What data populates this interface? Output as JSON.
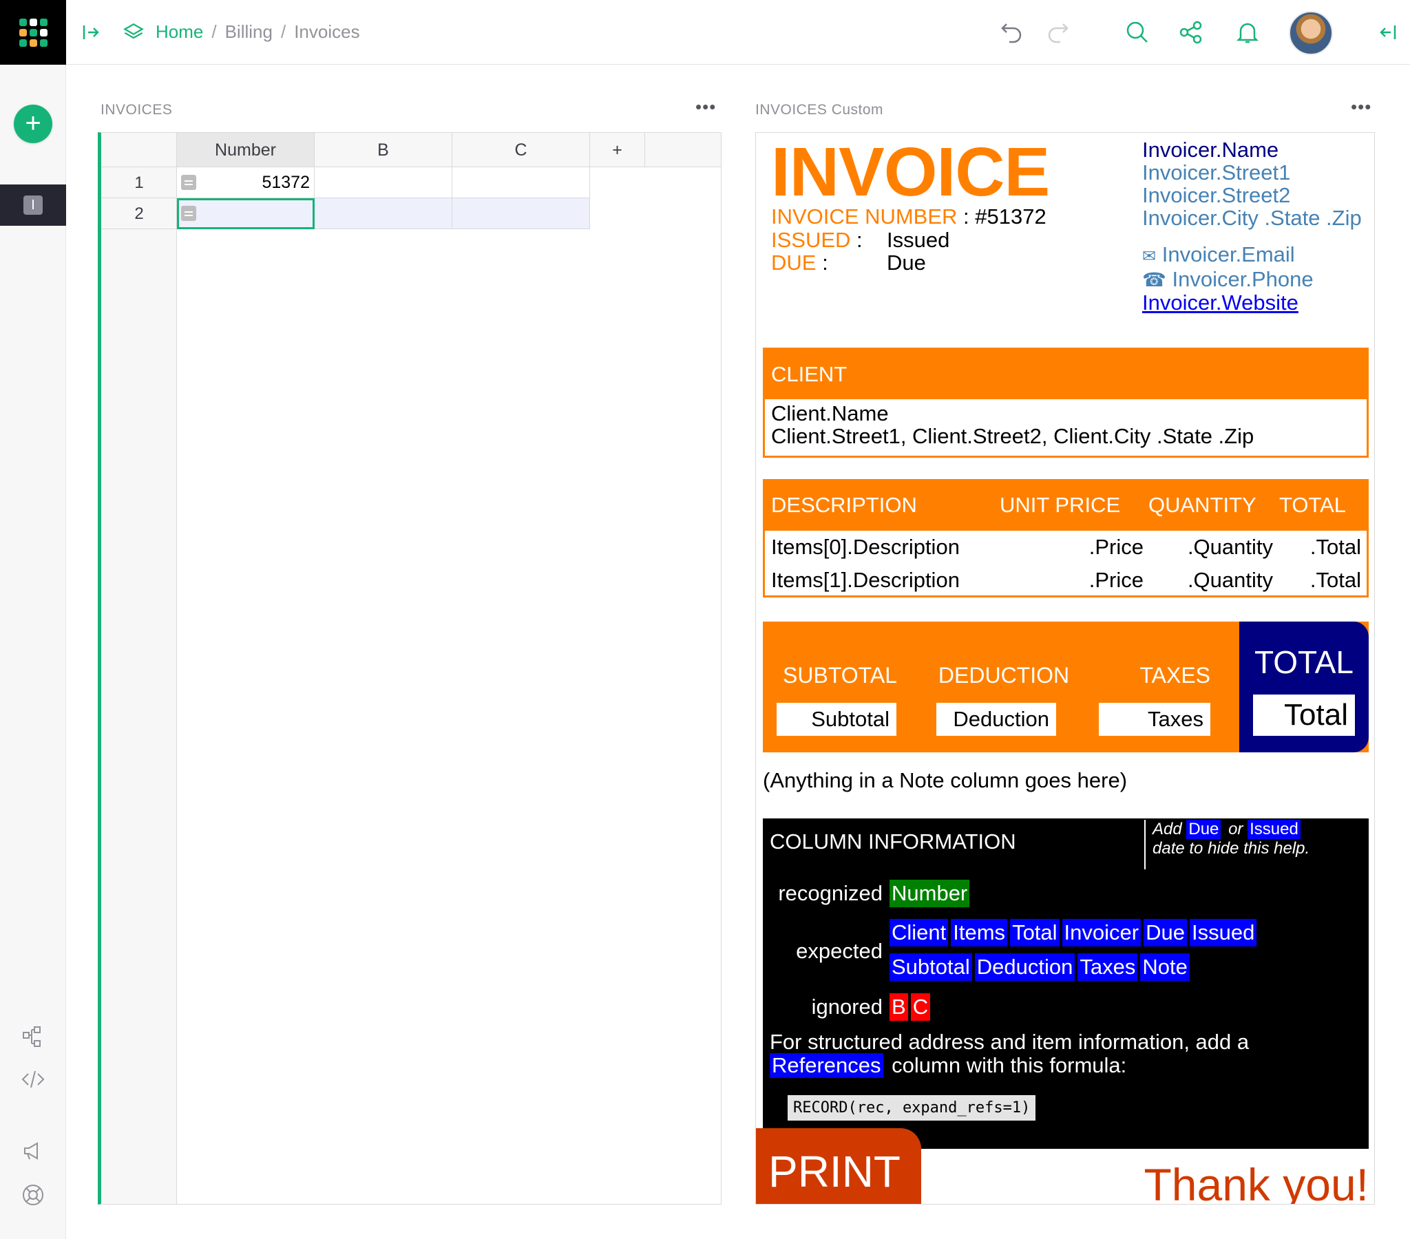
{
  "breadcrumb": {
    "home": "Home",
    "sep": "/",
    "billing": "Billing",
    "invoices": "Invoices"
  },
  "rail": {
    "page_letter": "I"
  },
  "left_section": {
    "title": "INVOICES",
    "menu": "•••",
    "columns": [
      "Number",
      "B",
      "C",
      "+"
    ],
    "rows": [
      {
        "num": "1",
        "Number": "51372",
        "B": "",
        "C": ""
      },
      {
        "num": "2",
        "Number": "",
        "B": "",
        "C": ""
      }
    ]
  },
  "right_section": {
    "title": "INVOICES Custom",
    "menu": "•••"
  },
  "invoice": {
    "title": "INVOICE",
    "number_label": "INVOICE NUMBER",
    "number_value": ": #51372",
    "issued_label": "ISSUED",
    "issued_value": "Issued",
    "due_label": "DUE",
    "due_value": "Due",
    "colon": ":",
    "invoicer": {
      "name": "Invoicer.Name",
      "street1": "Invoicer.Street1",
      "street2": "Invoicer.Street2",
      "city": "Invoicer.City .State .Zip",
      "email": "Invoicer.Email",
      "phone": "Invoicer.Phone",
      "website": "Invoicer.Website",
      "email_icon": "✉",
      "phone_icon": "☎"
    },
    "client": {
      "header": "CLIENT",
      "name": "Client.Name",
      "address": "Client.Street1, Client.Street2, Client.City .State .Zip"
    },
    "items": {
      "headers": {
        "description": "DESCRIPTION",
        "unit_price": "UNIT PRICE",
        "quantity": "QUANTITY",
        "total": "TOTAL"
      },
      "rows": [
        {
          "description": "Items[0].Description",
          "price": ".Price",
          "quantity": ".Quantity",
          "total": ".Total"
        },
        {
          "description": "Items[1].Description",
          "price": ".Price",
          "quantity": ".Quantity",
          "total": ".Total"
        }
      ]
    },
    "totals": {
      "subtotal_label": "SUBTOTAL",
      "subtotal_value": "Subtotal",
      "deduction_label": "DEDUCTION",
      "deduction_value": "Deduction",
      "taxes_label": "TAXES",
      "taxes_value": "Taxes",
      "total_label": "TOTAL",
      "total_value": "Total"
    },
    "note": "(Anything in a Note column goes here)",
    "column_info": {
      "header": "COLUMN INFORMATION",
      "help_add": "Add",
      "help_or": "or",
      "help_due": "Due",
      "help_issued": "Issued",
      "help_rest": "date to hide this help.",
      "recognized_label": "recognized",
      "recognized": [
        "Number"
      ],
      "expected_label": "expected",
      "expected_row1": [
        "Client",
        "Items",
        "Total",
        "Invoicer",
        "Due",
        "Issued"
      ],
      "expected_row2": [
        "Subtotal",
        "Deduction",
        "Taxes",
        "Note"
      ],
      "ignored_label": "ignored",
      "ignored": [
        "B",
        "C"
      ],
      "structured_text1": "For structured address and item information, add a",
      "references_tag": "References",
      "structured_text2": "column with this formula:",
      "formula": "RECORD(rec, expand_refs=1)"
    },
    "print_label": "PRINT",
    "thanks": "Thank you!"
  },
  "colors": {
    "accent_green": "#16b378",
    "invoice_orange": "#ff8000",
    "navy": "#000080",
    "tag_blue": "#0000ff",
    "tag_green": "#008000",
    "tag_red": "#ff0000",
    "print_red": "#d03a00"
  },
  "icons": {
    "logo": "grist-logo-icon",
    "add": "plus-icon",
    "collapse_left": "panel-open-icon",
    "pages": "layers-icon",
    "undo": "undo-icon",
    "redo": "redo-icon",
    "search": "search-icon",
    "share": "share-icon",
    "notifications": "bell-icon",
    "collapse_right": "panel-collapse-icon",
    "raw_data": "raw-data-icon",
    "code": "code-icon",
    "announce": "megaphone-icon",
    "help": "lifebuoy-icon"
  }
}
